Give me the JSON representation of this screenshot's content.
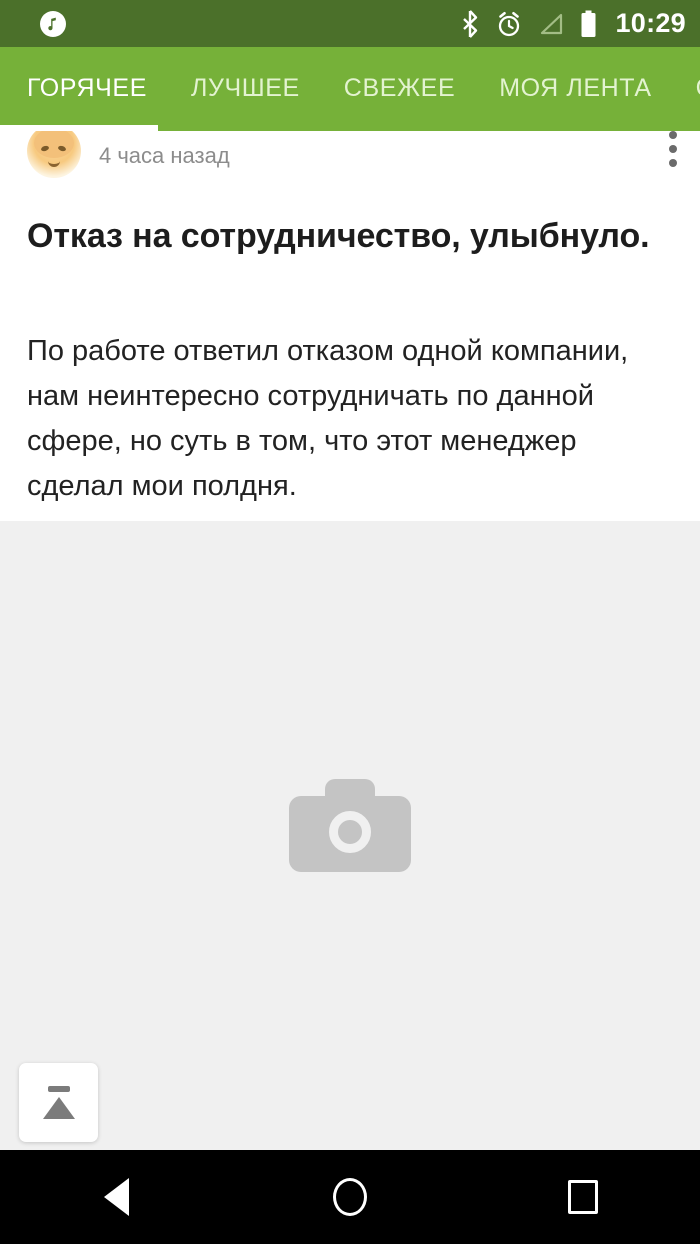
{
  "status_bar": {
    "time": "10:29",
    "background_color": "#4b702a",
    "icons": [
      {
        "name": "music-note-icon"
      },
      {
        "name": "bluetooth-icon"
      },
      {
        "name": "alarm-clock-icon"
      },
      {
        "name": "signal-no-service-icon"
      },
      {
        "name": "battery-full-icon"
      }
    ]
  },
  "tab_bar": {
    "background_color": "#76b139",
    "active_index": 0,
    "tabs": [
      {
        "label": "ГОРЯЧЕЕ"
      },
      {
        "label": "ЛУЧШЕЕ"
      },
      {
        "label": "СВЕЖЕЕ"
      },
      {
        "label": "МОЯ ЛЕНТА"
      },
      {
        "label": "СО"
      }
    ]
  },
  "post": {
    "author": "",
    "timestamp": "4 часа назад",
    "title": "Отказ на сотрудничество, улыбнуло.",
    "body": "По работе ответил отказом одной компании, нам неинтересно сотрудничать по данной сфере, но суть в том, что этот менеджер сделал мои полдня.",
    "overflow_menu": "⋮",
    "image": {
      "state": "placeholder",
      "icon": "camera-icon",
      "background_color": "#f0f0f0",
      "icon_color": "#c4c4c4"
    }
  },
  "scroll_to_top": {
    "icon": "eject-to-top-icon",
    "label": ""
  },
  "navigation_bar": {
    "background_color": "#000000",
    "buttons": [
      {
        "name": "back-button"
      },
      {
        "name": "home-button"
      },
      {
        "name": "recents-button"
      }
    ]
  }
}
